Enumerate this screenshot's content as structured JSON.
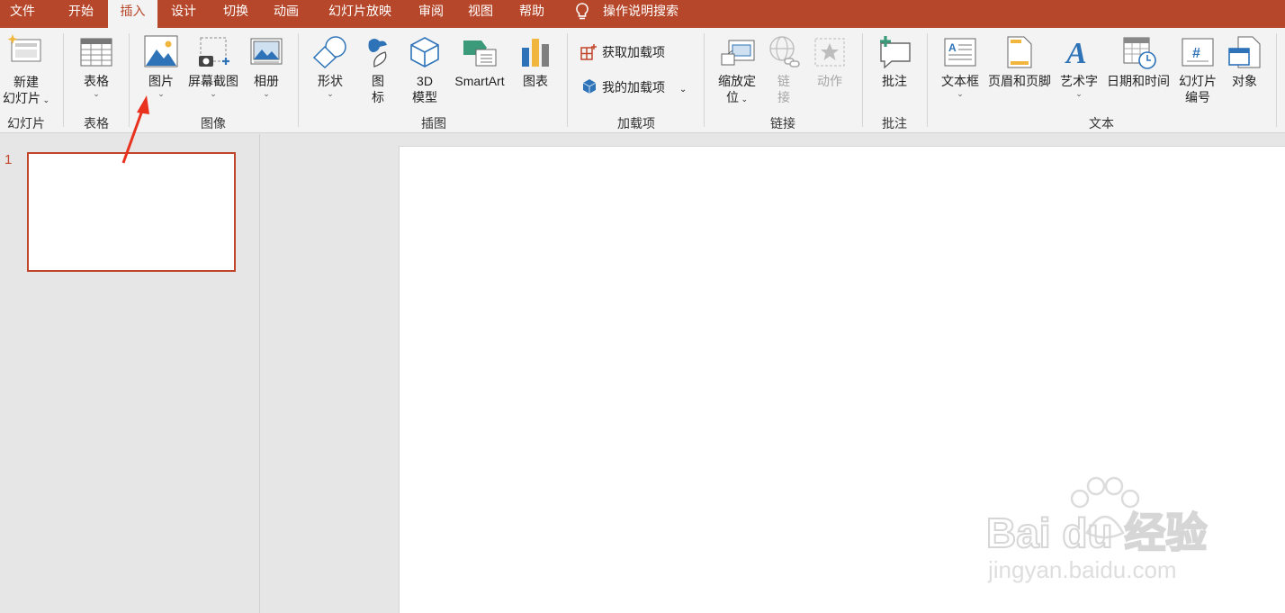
{
  "tabs": [
    "文件",
    "开始",
    "插入",
    "设计",
    "切换",
    "动画",
    "幻灯片放映",
    "审阅",
    "视图",
    "帮助"
  ],
  "tell_me": "操作说明搜索",
  "ribbon": {
    "slides": {
      "new_slide_line1": "新建",
      "new_slide_line2": "幻灯片",
      "group": "幻灯片"
    },
    "tables": {
      "table": "表格",
      "group": "表格"
    },
    "images": {
      "picture": "图片",
      "screenshot": "屏幕截图",
      "album": "相册",
      "group": "图像"
    },
    "illustrations": {
      "shapes": "形状",
      "icons_line1": "图",
      "icons_line2": "标",
      "model_line1": "3D",
      "model_line2": "模型",
      "smartart": "SmartArt",
      "chart": "图表",
      "group": "插图"
    },
    "addins": {
      "get": "获取加载项",
      "mine": "我的加载项",
      "group": "加载项"
    },
    "links": {
      "zoom_line1": "缩放定",
      "zoom_line2": "位",
      "link_line1": "链",
      "link_line2": "接",
      "action": "动作",
      "group": "链接"
    },
    "comments": {
      "comment": "批注",
      "group": "批注"
    },
    "text": {
      "textbox": "文本框",
      "header_footer": "页眉和页脚",
      "wordart": "艺术字",
      "datetime": "日期和时间",
      "slide_num_line1": "幻灯片",
      "slide_num_line2": "编号",
      "object": "对象",
      "group": "文本"
    }
  },
  "thumbnails": {
    "number": "1"
  },
  "watermark": {
    "brand": "Bai du 经验",
    "url": "jingyan.baidu.com"
  },
  "colors": {
    "accent": "#b7472a",
    "arrow": "#e8321e"
  }
}
